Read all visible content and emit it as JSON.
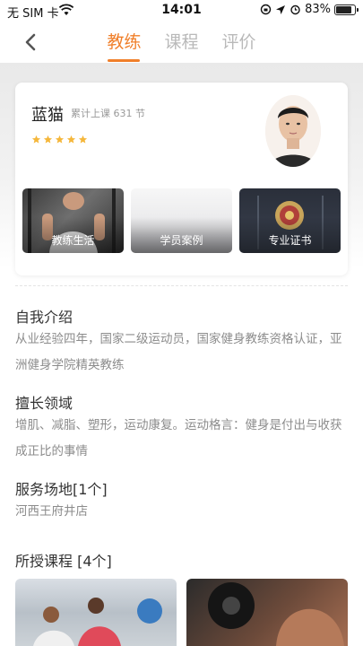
{
  "status_bar": {
    "carrier": "无 SIM 卡",
    "time": "14:01",
    "battery_text": "83%",
    "battery_level": 0.83
  },
  "nav": {
    "tabs": [
      {
        "label": "教练",
        "active": true
      },
      {
        "label": "课程",
        "active": false
      },
      {
        "label": "评价",
        "active": false
      }
    ]
  },
  "coach": {
    "name": "蓝猫",
    "lessons": "累计上课 631 节",
    "rating_stars": 5,
    "tiles": [
      {
        "label": "教练生活"
      },
      {
        "label": "学员案例"
      },
      {
        "label": "专业证书"
      }
    ]
  },
  "sections": {
    "intro": {
      "title": "自我介绍",
      "text": "从业经验四年，国家二级运动员，国家健身教练资格认证，亚洲健身学院精英教练"
    },
    "specialty": {
      "title": "擅长领域",
      "text": "增肌、减脂、塑形，运动康复。运动格言：健身是付出与收获成正比的事情"
    },
    "venues": {
      "title": "服务场地[1个]",
      "text": "河西王府井店"
    },
    "courses": {
      "title": "所授课程 [4个]"
    }
  },
  "colors": {
    "accent": "#f07f2a",
    "star": "#f5b73b",
    "muted_text": "#8c8c8c"
  }
}
